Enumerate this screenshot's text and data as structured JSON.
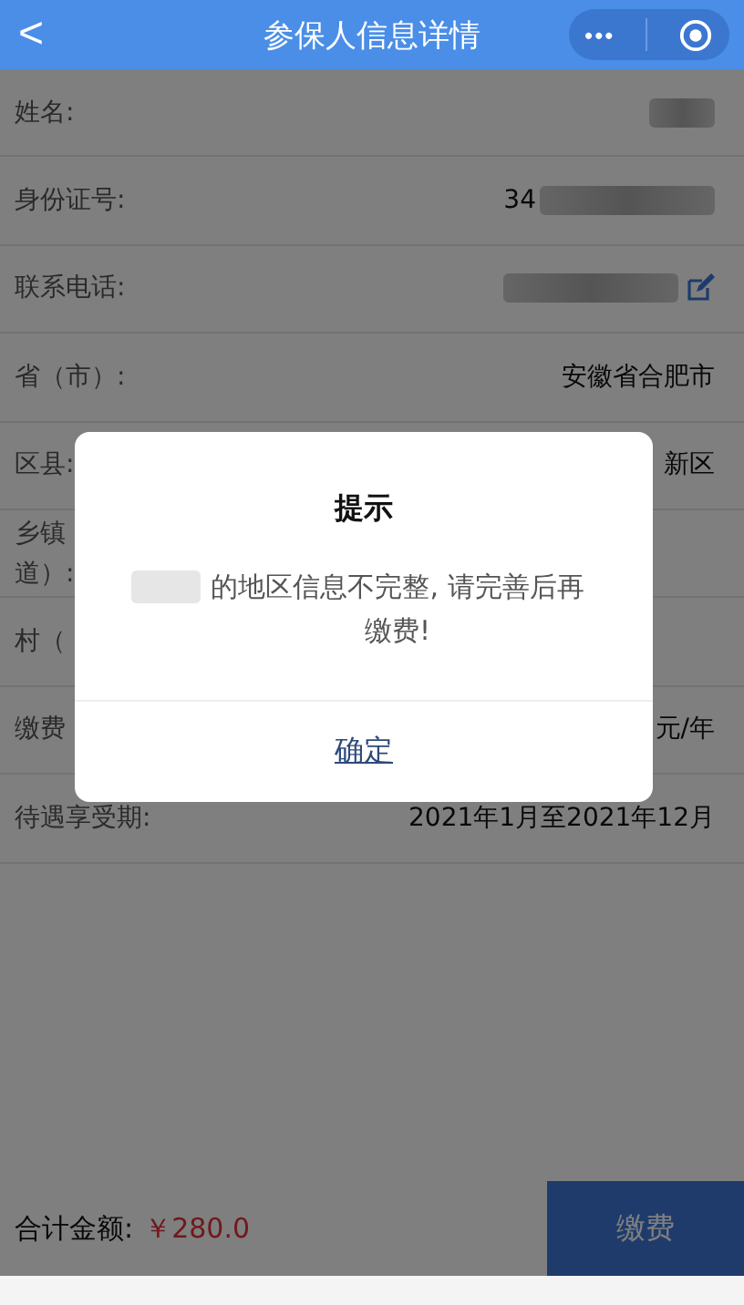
{
  "header": {
    "title": "参保人信息详情",
    "back_icon": "<",
    "more_icon": "•••"
  },
  "rows": [
    {
      "label": [
        "姓名:"
      ],
      "value": "",
      "redacted": true,
      "editable": false
    },
    {
      "label": [
        "身份证号:"
      ],
      "value": "34",
      "redacted": true,
      "editable": false
    },
    {
      "label": [
        "联系电话:"
      ],
      "value": "",
      "redacted": true,
      "editable": true
    },
    {
      "label": [
        "省（市）:"
      ],
      "value": "安徽省合肥市",
      "redacted": false,
      "editable": false
    },
    {
      "label": [
        "区县:"
      ],
      "value": "新区",
      "redacted": false,
      "editable": false
    },
    {
      "label": [
        "乡镇",
        "道）:"
      ],
      "value": "",
      "redacted": false,
      "editable": false
    },
    {
      "label": [
        "村（"
      ],
      "value": "",
      "redacted": false,
      "editable": false
    },
    {
      "label": [
        "缴费"
      ],
      "value": "元/年",
      "redacted": false,
      "editable": false
    },
    {
      "label": [
        "待遇享受期:"
      ],
      "value": "2021年1月至2021年12月",
      "redacted": false,
      "editable": false
    }
  ],
  "footer": {
    "total_label": "合计金额:",
    "total_amount": "￥280.0",
    "pay_button": "缴费"
  },
  "dialog": {
    "title": "提示",
    "message_redacted": true,
    "message": "的地区信息不完整, 请完善后再缴费!",
    "confirm": "确定"
  }
}
